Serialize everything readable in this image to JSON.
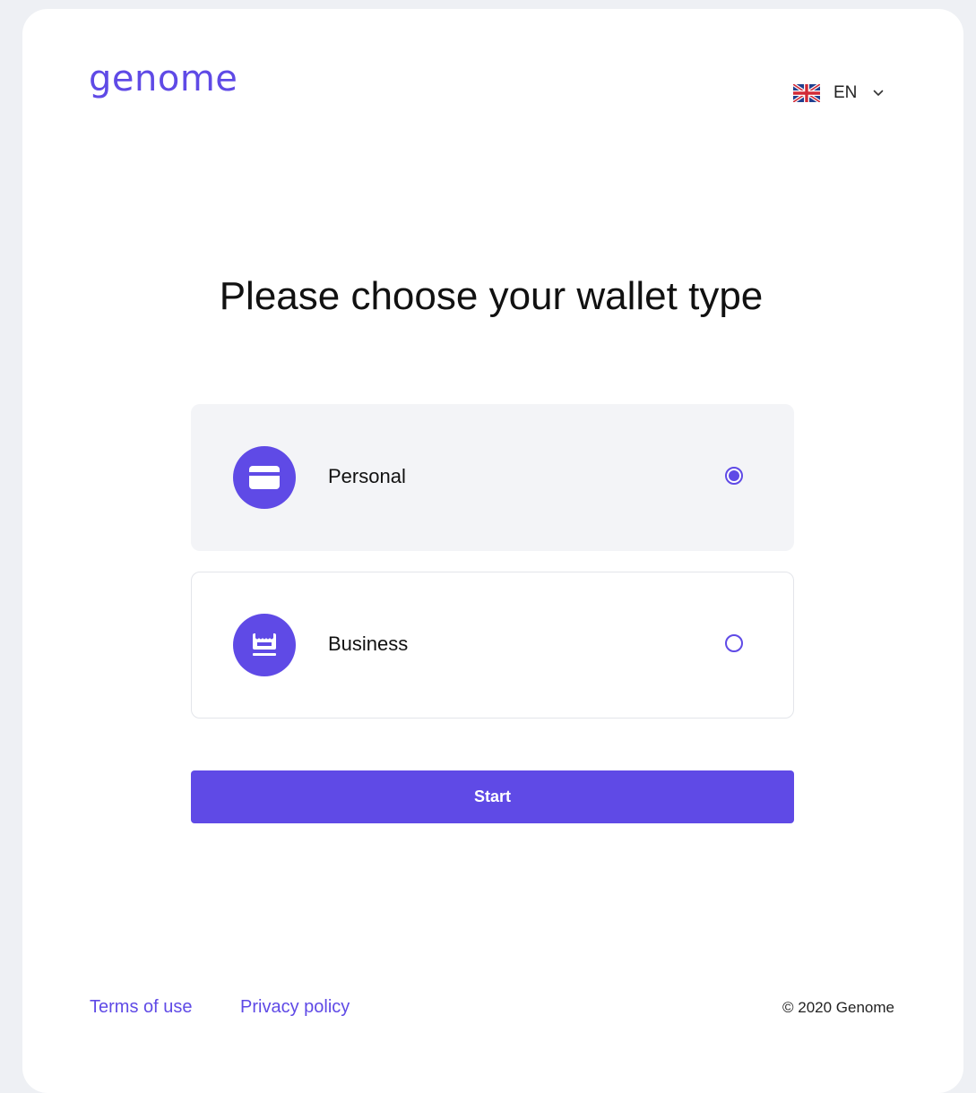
{
  "header": {
    "logo_text": "genome",
    "language": {
      "code": "EN",
      "flag_icon": "uk-flag-icon",
      "dropdown_icon": "chevron-down-icon"
    }
  },
  "main": {
    "title": "Please choose your wallet type",
    "options": [
      {
        "label": "Personal",
        "icon": "card-icon",
        "selected": true
      },
      {
        "label": "Business",
        "icon": "storefront-icon",
        "selected": false
      }
    ],
    "start_label": "Start"
  },
  "footer": {
    "terms_label": "Terms of use",
    "privacy_label": "Privacy policy",
    "copyright": "© 2020 Genome"
  },
  "colors": {
    "accent": "#5f4ae6",
    "selected_background": "#f3f4f7",
    "page_background": "#eef0f4"
  }
}
